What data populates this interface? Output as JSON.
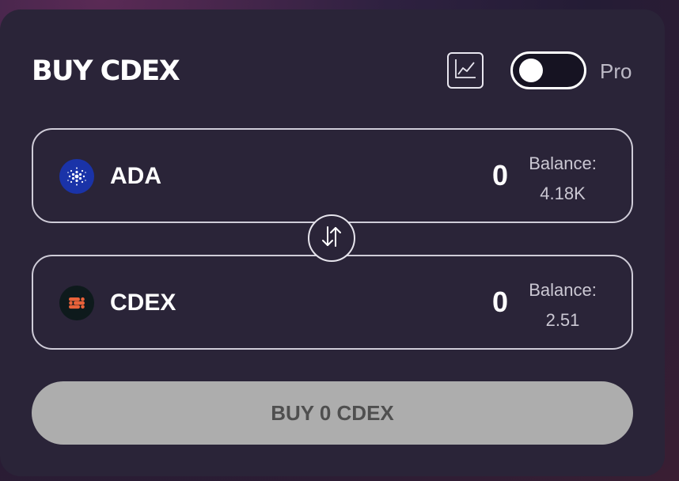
{
  "header": {
    "title": "BUY CDEX",
    "chart_button_icon": "line-chart-icon",
    "toggle_label": "Pro",
    "toggle_state": "off"
  },
  "from_token": {
    "symbol": "ADA",
    "icon": "cardano-icon",
    "amount": "0",
    "balance_label": "Balance:",
    "balance_value": "4.18K"
  },
  "swap_icon": "swap-arrows-icon",
  "to_token": {
    "symbol": "CDEX",
    "icon": "cdex-icon",
    "amount": "0",
    "balance_label": "Balance:",
    "balance_value": "2.51"
  },
  "buy_button": {
    "label": "BUY 0 CDEX"
  },
  "colors": {
    "card_bg": "#2a2438",
    "button_disabled_bg": "#adadad",
    "cardano_blue": "#1a33a8",
    "cdex_orange": "#e8623a"
  }
}
